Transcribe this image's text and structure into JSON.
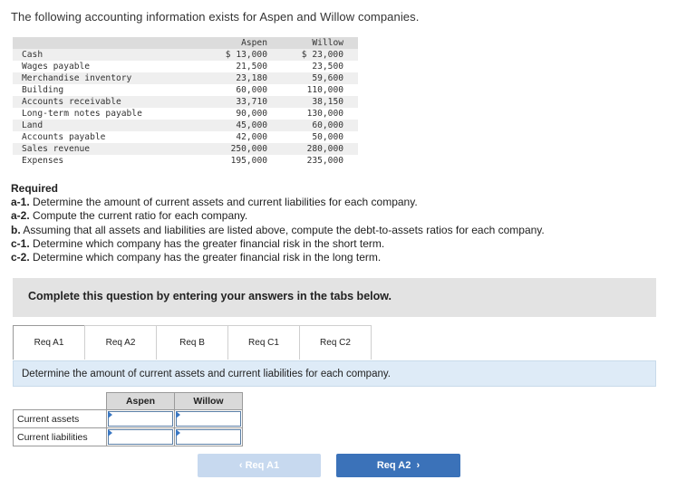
{
  "intro": "The following accounting information exists for Aspen and Willow companies.",
  "data_table": {
    "headers": [
      "Aspen",
      "Willow"
    ],
    "rows": [
      {
        "label": "Cash",
        "aspen": "$ 13,000",
        "willow": "$ 23,000"
      },
      {
        "label": "Wages payable",
        "aspen": "21,500",
        "willow": "23,500"
      },
      {
        "label": "Merchandise inventory",
        "aspen": "23,180",
        "willow": "59,600"
      },
      {
        "label": "Building",
        "aspen": "60,000",
        "willow": "110,000"
      },
      {
        "label": "Accounts receivable",
        "aspen": "33,710",
        "willow": "38,150"
      },
      {
        "label": "Long-term notes payable",
        "aspen": "90,000",
        "willow": "130,000"
      },
      {
        "label": "Land",
        "aspen": "45,000",
        "willow": "60,000"
      },
      {
        "label": "Accounts payable",
        "aspen": "42,000",
        "willow": "50,000"
      },
      {
        "label": "Sales revenue",
        "aspen": "250,000",
        "willow": "280,000"
      },
      {
        "label": "Expenses",
        "aspen": "195,000",
        "willow": "235,000"
      }
    ]
  },
  "required": {
    "header": "Required",
    "lines": [
      {
        "key": "a-1.",
        "text": " Determine the amount of current assets and current liabilities for each company."
      },
      {
        "key": "a-2.",
        "text": " Compute the current ratio for each company."
      },
      {
        "key": "b.",
        "text": " Assuming that all assets and liabilities are listed above, compute the debt-to-assets ratios for each company."
      },
      {
        "key": "c-1.",
        "text": " Determine which company has the greater financial risk in the short term."
      },
      {
        "key": "c-2.",
        "text": " Determine which company has the greater financial risk in the long term."
      }
    ]
  },
  "banner": "Complete this question by entering your answers in the tabs below.",
  "tabs": [
    "Req A1",
    "Req A2",
    "Req B",
    "Req C1",
    "Req C2"
  ],
  "active_tab": "Req A1",
  "instruction": "Determine the amount of current assets and current liabilities for each company.",
  "answer_table": {
    "headers": [
      "Aspen",
      "Willow"
    ],
    "rows": [
      {
        "label": "Current assets",
        "aspen_value": "",
        "willow_value": ""
      },
      {
        "label": "Current liabilities",
        "aspen_value": "",
        "willow_value": ""
      }
    ]
  },
  "nav": {
    "prev_label": "Req A1",
    "prev_chevron": "‹",
    "next_label": "Req A2",
    "next_chevron": "›"
  },
  "colors": {
    "banner_bg": "#e3e3e3",
    "instruction_bg": "#deebf7",
    "next_button": "#3b72b9",
    "prev_button_disabled": "#c7d9ef"
  }
}
